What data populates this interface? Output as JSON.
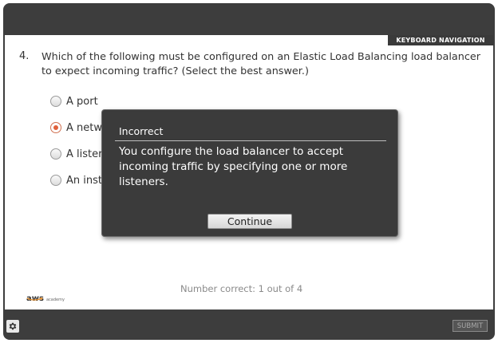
{
  "header": {
    "keyboard_nav_label": "KEYBOARD NAVIGATION"
  },
  "question": {
    "number": "4.",
    "text": "Which of the following must be configured on an Elastic Load Balancing load balancer to expect incoming traffic? (Select the best answer.)",
    "options": [
      {
        "label": "A port",
        "selected": false
      },
      {
        "label": "A netw",
        "selected": true
      },
      {
        "label": "A lister",
        "selected": false
      },
      {
        "label": "An inst",
        "selected": false
      }
    ]
  },
  "feedback": {
    "title": "Incorrect",
    "message": "You configure the load balancer to accept incoming traffic by specifying one or more listeners.",
    "continue_label": "Continue"
  },
  "footer": {
    "score_text": "Number correct: 1 out of 4",
    "brand_main": "aws",
    "brand_sub": "academy",
    "submit_label": "SUBMIT",
    "settings_icon": "gear-icon"
  },
  "colors": {
    "frame": "#3d3d3d",
    "selected_radio": "#e0603a",
    "modal_bg": "#3b3b3b"
  }
}
